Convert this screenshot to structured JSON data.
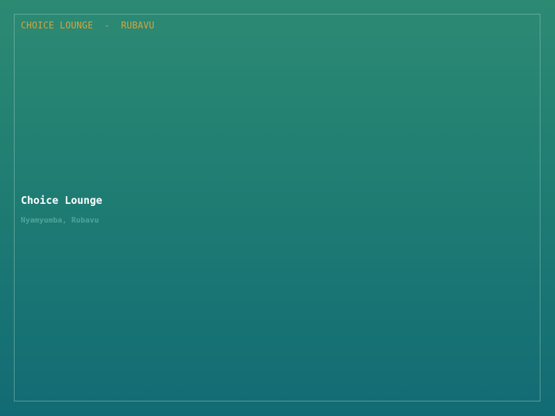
{
  "header": {
    "title": "CHOICE LOUNGE  -  RUBAVU"
  },
  "venue": {
    "name": "Choice Lounge",
    "location": "Nyamyumba, Rubavu"
  },
  "colors": {
    "accent": "#d9a43a",
    "background_top": "#2c8a73",
    "background_bottom": "#126b74",
    "frame_border": "#96c8be",
    "name_text": "#ffffff",
    "location_text": "#4fa49a"
  }
}
